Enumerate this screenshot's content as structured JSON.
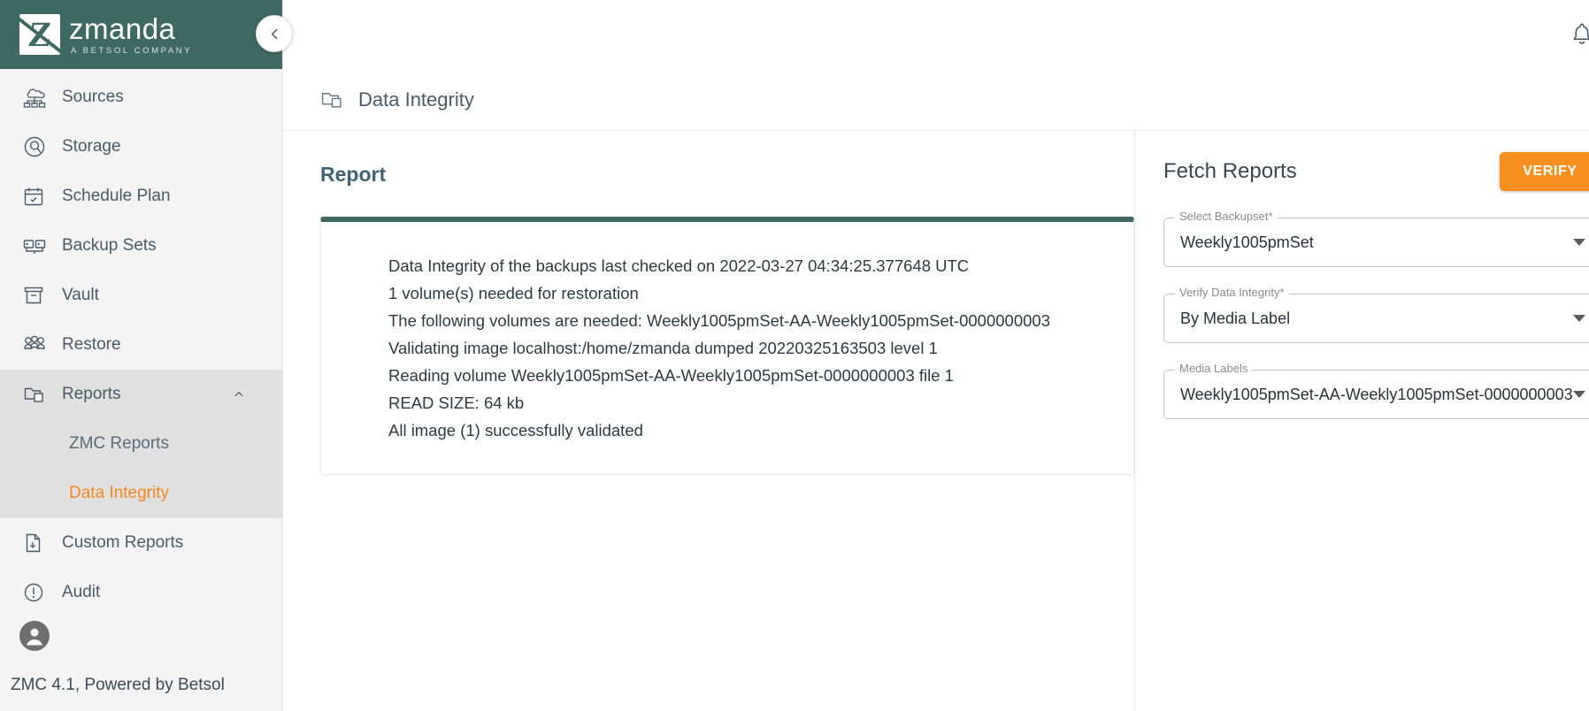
{
  "brand": {
    "name": "zmanda",
    "tagline": "A BETSOL COMPANY"
  },
  "sidebar": {
    "items": [
      {
        "label": "Sources",
        "icon": "sources-icon"
      },
      {
        "label": "Storage",
        "icon": "storage-icon"
      },
      {
        "label": "Schedule Plan",
        "icon": "calendar-icon"
      },
      {
        "label": "Backup Sets",
        "icon": "backup-sets-icon"
      },
      {
        "label": "Vault",
        "icon": "vault-icon"
      },
      {
        "label": "Restore",
        "icon": "restore-icon"
      }
    ],
    "reports_group": {
      "label": "Reports",
      "expanded": true,
      "sub_items": [
        {
          "label": "ZMC Reports",
          "active": false
        },
        {
          "label": "Data Integrity",
          "active": true
        }
      ]
    },
    "lower_items": [
      {
        "label": "Custom Reports",
        "icon": "custom-report-icon"
      },
      {
        "label": "Audit",
        "icon": "audit-icon"
      }
    ],
    "footer_version": "ZMC 4.1, Powered by Betsol"
  },
  "page": {
    "title": "Data Integrity",
    "report_heading": "Report",
    "report_lines": [
      "Data Integrity of the backups last checked on 2022-03-27 04:34:25.377648 UTC",
      "1 volume(s) needed for restoration",
      "The following volumes are needed: Weekly1005pmSet-AA-Weekly1005pmSet-0000000003",
      "Validating image localhost:/home/zmanda dumped 20220325163503 level 1",
      "Reading volume Weekly1005pmSet-AA-Weekly1005pmSet-0000000003 file 1",
      "READ SIZE: 64 kb",
      "All image (1) successfully validated"
    ]
  },
  "fetch_panel": {
    "title": "Fetch Reports",
    "verify_label": "VERIFY",
    "fields": [
      {
        "legend": "Select Backupset*",
        "value": "Weekly1005pmSet"
      },
      {
        "legend": "Verify Data Integrity*",
        "value": "By Media Label"
      },
      {
        "legend": "Media Labels",
        "value": "Weekly1005pmSet-AA-Weekly1005pmSet-0000000003"
      }
    ]
  },
  "colors": {
    "brand_green": "#3f6963",
    "accent_orange": "#f7901e",
    "active_link": "#f4881f",
    "sidebar_bg": "#f4f4f4",
    "sidebar_group_bg": "#e0e0e0"
  }
}
